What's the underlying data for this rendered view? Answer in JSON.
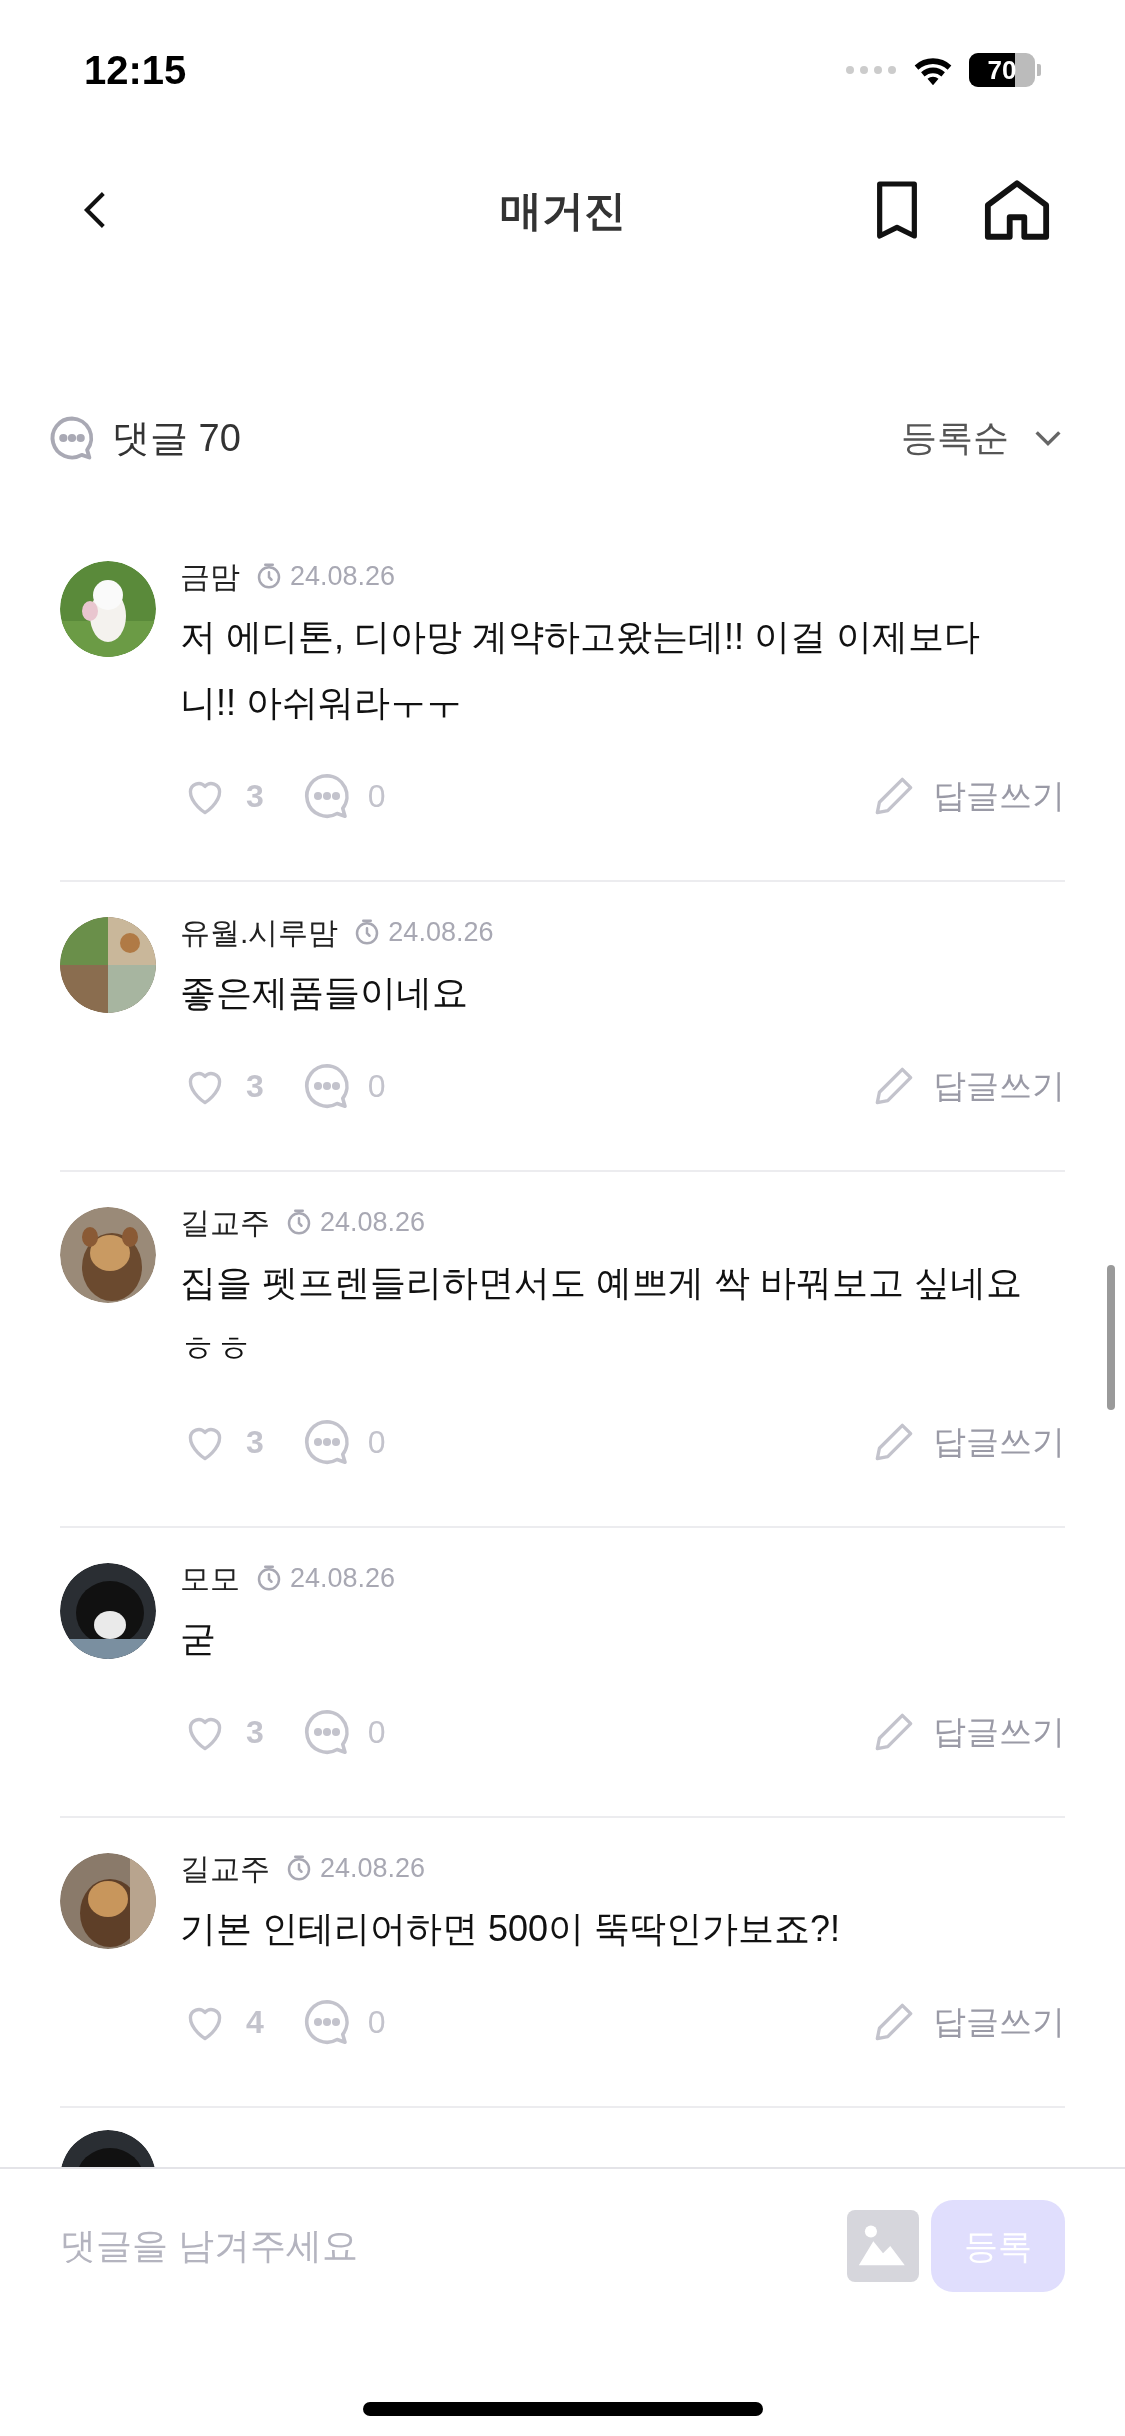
{
  "status_bar": {
    "time": "12:15",
    "battery": "70"
  },
  "header": {
    "title": "매거진"
  },
  "comments_header": {
    "label": "댓글 70",
    "sort": "등록순"
  },
  "comments": [
    {
      "name": "금맘",
      "date": "24.08.26",
      "text": "저 에디톤, 디아망 계약하고왔는데!! 이걸 이제보다니!! 아쉬워라ㅜㅜ",
      "likes": "3",
      "replies": "0",
      "reply_label": "답글쓰기"
    },
    {
      "name": "유월.시루맘",
      "date": "24.08.26",
      "text": "좋은제품들이네요",
      "likes": "3",
      "replies": "0",
      "reply_label": "답글쓰기"
    },
    {
      "name": "길교주",
      "date": "24.08.26",
      "text": "집을 펫프렌들리하면서도 예쁘게 싹 바꿔보고 싶네요 ㅎㅎ",
      "likes": "3",
      "replies": "0",
      "reply_label": "답글쓰기"
    },
    {
      "name": "모모",
      "date": "24.08.26",
      "text": "굳",
      "likes": "3",
      "replies": "0",
      "reply_label": "답글쓰기"
    },
    {
      "name": "길교주",
      "date": "24.08.26",
      "text": "기본 인테리어하면 500이 뚝딱인가보죠?!",
      "likes": "4",
      "replies": "0",
      "reply_label": "답글쓰기"
    }
  ],
  "composer": {
    "placeholder": "댓글을 남겨주세요",
    "submit": "등록",
    "submit_disabled": true
  }
}
